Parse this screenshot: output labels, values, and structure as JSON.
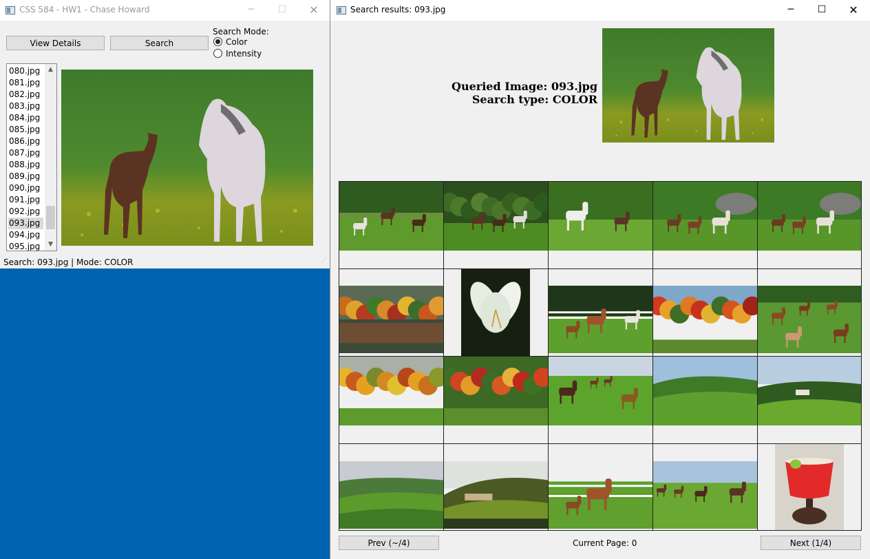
{
  "left_window": {
    "title": "CSS 584 - HW1 - Chase Howard",
    "view_details_label": "View Details",
    "search_label": "Search",
    "search_mode_label": "Search Mode:",
    "mode_color_label": "Color",
    "mode_intensity_label": "Intensity",
    "selected_mode": "Color",
    "files": [
      "080.jpg",
      "081.jpg",
      "082.jpg",
      "083.jpg",
      "084.jpg",
      "085.jpg",
      "086.jpg",
      "087.jpg",
      "088.jpg",
      "089.jpg",
      "090.jpg",
      "091.jpg",
      "092.jpg",
      "093.jpg",
      "094.jpg",
      "095.jpg"
    ],
    "selected_file": "093.jpg",
    "status": "Search: 093.jpg | Mode: COLOR"
  },
  "right_window": {
    "title": "Search results: 093.jpg",
    "queried_line": "Queried Image: 093.jpg",
    "search_type_line": "Search type: COLOR",
    "prev_label": "Prev (~/4)",
    "next_label": "Next (1/4)",
    "current_page_label": "Current Page: 0",
    "results": [
      "horses-fence",
      "horses-trees",
      "white-horse-foal",
      "horses-rocks-1",
      "horses-rocks-2",
      "autumn-lake",
      "white-lily",
      "horses-white-fence",
      "autumn-trees",
      "cows-field",
      "autumn-meadow",
      "autumn-forest",
      "riders-herd",
      "green-valley",
      "farm-hills",
      "rolling-fields",
      "village-hills",
      "mare-foal-fence",
      "cowboys-herd",
      "red-drink"
    ]
  },
  "colors": {
    "desktop": "#0063b1",
    "window_bg": "#f0f0f0",
    "titlebar_bg": "#ffffff"
  }
}
